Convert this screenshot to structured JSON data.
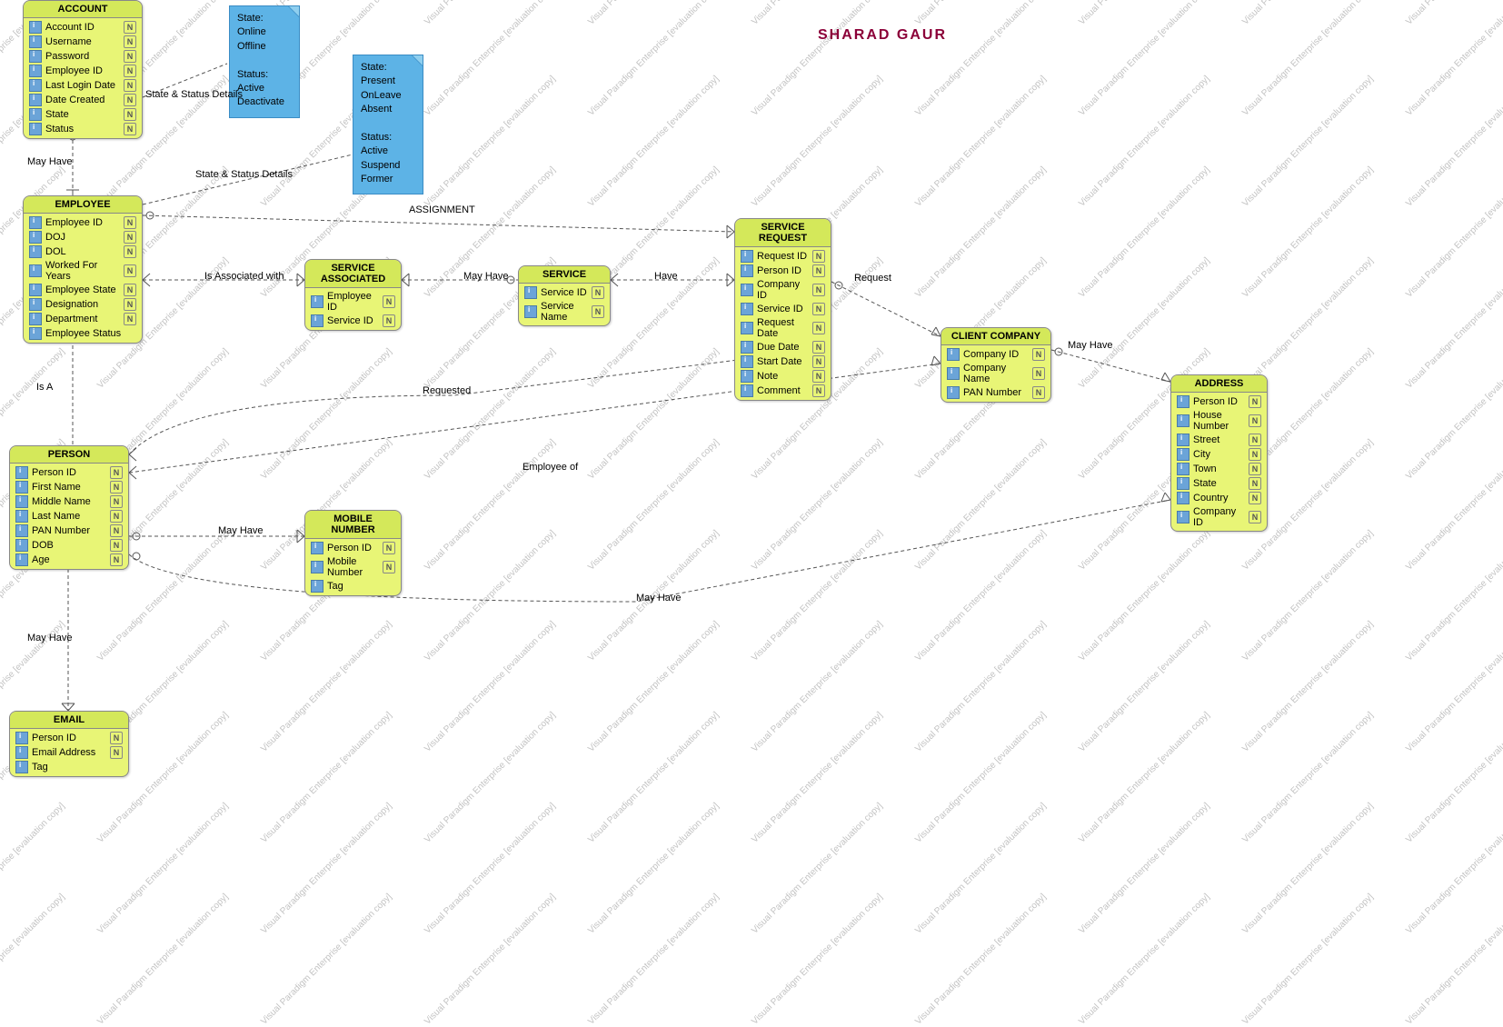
{
  "watermark_text": "Visual Paradigm Enterprise [evaluation copy]",
  "author": "SHARAD GAUR",
  "notes": {
    "note1": {
      "lines": [
        "State:",
        "Online",
        "Offline",
        "",
        "Status:",
        "Active",
        "Deactivate"
      ]
    },
    "note2": {
      "lines": [
        "State:",
        "Present",
        "OnLeave",
        "Absent",
        "",
        "Status:",
        "Active",
        "Suspend",
        "Former"
      ]
    }
  },
  "entities": {
    "account": {
      "title": "ACCOUNT",
      "attrs": [
        "Account ID",
        "Username",
        "Password",
        "Employee ID",
        "Last Login Date",
        "Date Created",
        "State",
        "Status"
      ],
      "n": [
        true,
        true,
        true,
        true,
        true,
        true,
        true,
        true
      ]
    },
    "employee": {
      "title": "EMPLOYEE",
      "attrs": [
        "Employee ID",
        "DOJ",
        "DOL",
        "Worked For Years",
        "Employee State",
        "Designation",
        "Department",
        "Employee Status"
      ],
      "n": [
        true,
        true,
        true,
        true,
        true,
        true,
        true,
        false
      ]
    },
    "person": {
      "title": "PERSON",
      "attrs": [
        "Person ID",
        "First Name",
        "Middle Name",
        "Last Name",
        "PAN Number",
        "DOB",
        "Age"
      ],
      "n": [
        true,
        true,
        true,
        true,
        true,
        true,
        true
      ]
    },
    "email": {
      "title": "EMAIL",
      "attrs": [
        "Person ID",
        "Email Address",
        "Tag"
      ],
      "n": [
        true,
        true,
        false
      ]
    },
    "service_associated": {
      "title": "SERVICE ASSOCIATED",
      "attrs": [
        "Employee ID",
        "Service ID"
      ],
      "n": [
        true,
        true
      ]
    },
    "service": {
      "title": "SERVICE",
      "attrs": [
        "Service ID",
        "Service Name"
      ],
      "n": [
        true,
        true
      ]
    },
    "mobile_number": {
      "title": "MOBILE NUMBER",
      "attrs": [
        "Person ID",
        "Mobile Number",
        "Tag"
      ],
      "n": [
        true,
        true,
        false
      ]
    },
    "service_request": {
      "title": "SERVICE REQUEST",
      "attrs": [
        "Request ID",
        "Person ID",
        "Company ID",
        "Service ID",
        "Request Date",
        "Due Date",
        "Start Date",
        "Note",
        "Comment"
      ],
      "n": [
        true,
        true,
        true,
        true,
        true,
        true,
        true,
        true,
        true
      ]
    },
    "client_company": {
      "title": "CLIENT COMPANY",
      "attrs": [
        "Company ID",
        "Company Name",
        "PAN Number"
      ],
      "n": [
        true,
        true,
        true
      ]
    },
    "address": {
      "title": "ADDRESS",
      "attrs": [
        "Person ID",
        "House Number",
        "Street",
        "City",
        "Town",
        "State",
        "Country",
        "Company ID"
      ],
      "n": [
        true,
        true,
        true,
        true,
        true,
        true,
        true,
        true
      ]
    }
  },
  "labels": {
    "state_status_1": "State & Status Details",
    "state_status_2": "State & Status Details",
    "may_have_1": "May Have",
    "is_a": "Is A",
    "may_have_2": "May Have",
    "assignment": "ASSIGNMENT",
    "is_associated": "Is Associated with",
    "may_have_3": "May Have",
    "have": "Have",
    "request": "Request",
    "may_have_4": "May Have",
    "requested": "Requested",
    "employee_of": "Employee of",
    "may_have_5": "May Have",
    "may_have_6": "May Have"
  }
}
